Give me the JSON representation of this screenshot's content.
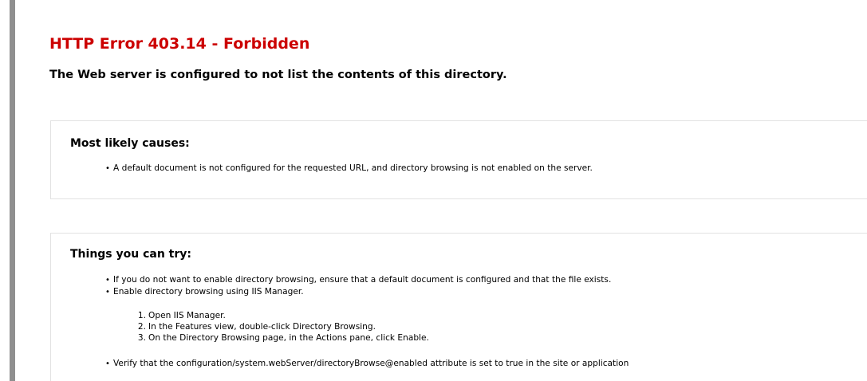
{
  "error": {
    "title": "HTTP Error 403.14 - Forbidden",
    "subtitle": "The Web server is configured to not list the contents of this directory."
  },
  "causes": {
    "heading": "Most likely causes:",
    "items": [
      "A default document is not configured for the requested URL, and directory browsing is not enabled on the server."
    ]
  },
  "try": {
    "heading": "Things you can try:",
    "items": [
      "If you do not want to enable directory browsing, ensure that a default document is configured and that the file exists.",
      "Enable directory browsing using IIS Manager.",
      "Verify that the configuration/system.webServer/directoryBrowse@enabled attribute is set to true in the site or application"
    ],
    "steps": [
      "Open IIS Manager.",
      "In the Features view, double-click Directory Browsing.",
      "On the Directory Browsing page, in the Actions pane, click Enable."
    ],
    "step_numbers": [
      "1.",
      "2.",
      "3."
    ]
  },
  "bullet_glyph": "•",
  "colors": {
    "title": "#cc0000",
    "left_rule": "#8f8f8f",
    "panel_border": "#e2e2e2"
  }
}
